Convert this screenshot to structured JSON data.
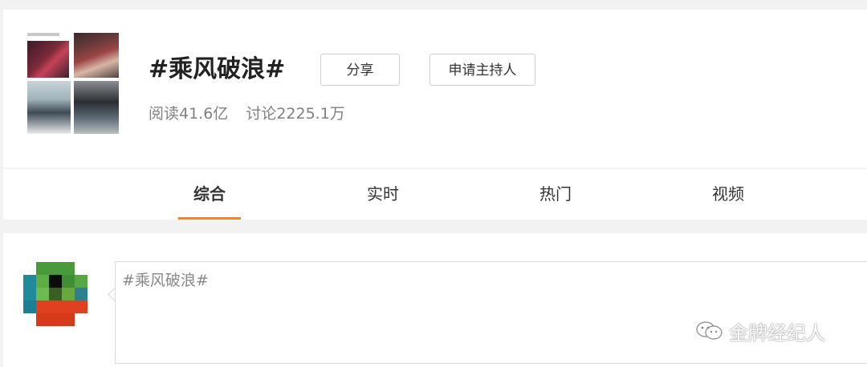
{
  "topic": {
    "title": "#乘风破浪#",
    "share_label": "分享",
    "apply_host_label": "申请主持人",
    "stats": {
      "reads": "阅读41.6亿",
      "discussions": "讨论2225.1万"
    }
  },
  "tabs": [
    {
      "label": "综合",
      "active": true
    },
    {
      "label": "实时",
      "active": false
    },
    {
      "label": "热门",
      "active": false
    },
    {
      "label": "视频",
      "active": false
    }
  ],
  "composer": {
    "text": "#乘风破浪#"
  },
  "watermark": {
    "text": "金牌经纪人",
    "icon": "wechat-icon"
  },
  "colors": {
    "accent": "#ff8200",
    "page_bg": "#f2f2f2"
  }
}
